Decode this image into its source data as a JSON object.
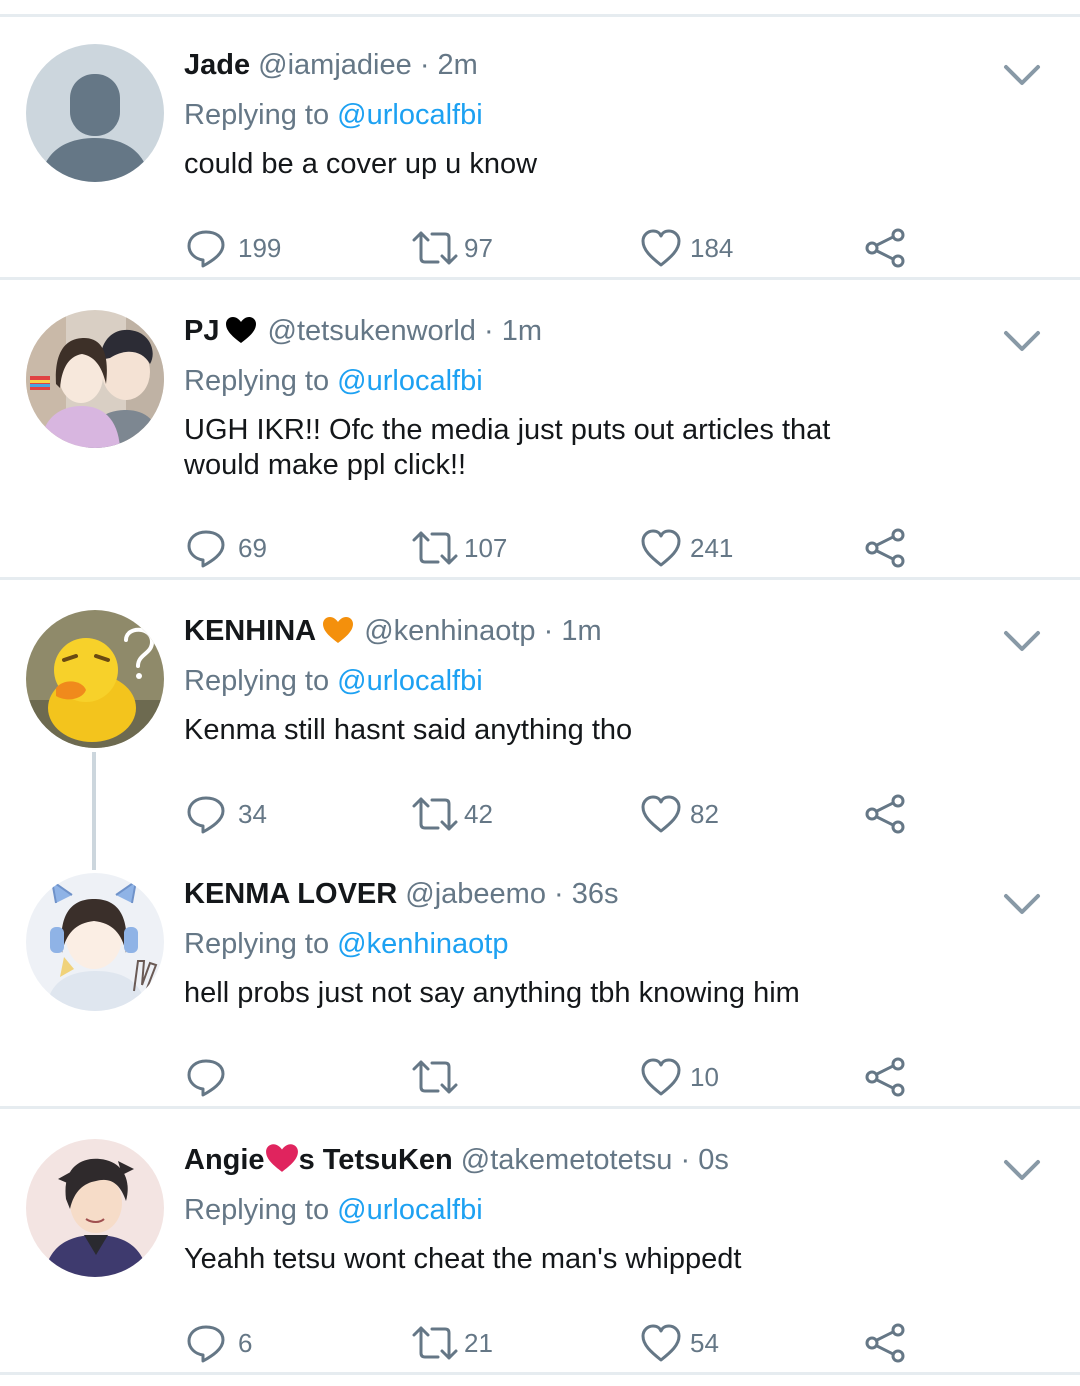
{
  "tweets": [
    {
      "name": "Jade",
      "name_suffix": "",
      "handle": "@iamjadiee",
      "time": "2m",
      "reply_prefix": "Replying to",
      "reply_to": "@urlocalfbi",
      "text": "could be a cover up u know",
      "replies": "199",
      "retweets": "97",
      "likes": "184",
      "avatar": "default-avatar"
    },
    {
      "name": "PJ",
      "name_suffix": "",
      "heart_color": "#000000",
      "handle": "@tetsukenworld",
      "time": "1m",
      "reply_prefix": "Replying to",
      "reply_to": "@urlocalfbi",
      "text": "UGH IKR!! Ofc the media just puts out articles that would make ppl click!!",
      "replies": "69",
      "retweets": "107",
      "likes": "241",
      "avatar": "anime-couple-avatar"
    },
    {
      "name": "KENHINA",
      "name_suffix": "",
      "heart_color": "#f4900c",
      "handle": "@kenhinaotp",
      "time": "1m",
      "reply_prefix": "Replying to",
      "reply_to": "@urlocalfbi",
      "text": "Kenma still hasnt said anything tho",
      "replies": "34",
      "retweets": "42",
      "likes": "82",
      "avatar": "duck-avatar"
    },
    {
      "name": "KENMA LOVER",
      "name_suffix": "",
      "handle": "@jabeemo",
      "time": "36s",
      "reply_prefix": "Replying to",
      "reply_to": "@kenhinaotp",
      "text": "hell probs just not say anything tbh knowing him",
      "replies": "",
      "retweets": "",
      "likes": "10",
      "avatar": "anime-headphones-avatar"
    },
    {
      "name": "Angie",
      "name_suffix": "s TetsuKen",
      "heart_color": "#e0245e",
      "handle": "@takemetotetsu",
      "time": "0s",
      "reply_prefix": "Replying to",
      "reply_to": "@urlocalfbi",
      "text": "Yeahh tetsu wont cheat the man's whippedt",
      "replies": "6",
      "retweets": "21",
      "likes": "54",
      "avatar": "anime-man-avatar"
    }
  ],
  "separator": "·",
  "colors": {
    "link": "#1da1f2",
    "secondary": "#657786",
    "divider": "#e6ecf0"
  }
}
